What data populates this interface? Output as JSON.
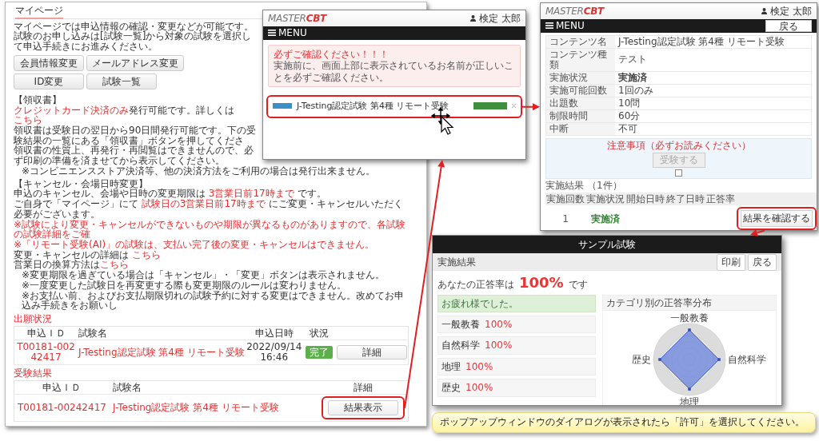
{
  "mypage": {
    "title": "マイページ",
    "intro": [
      "マイページでは申込情報の確認・変更などが可能です。",
      "試験のお申し込みは[試験一覧]から対象の試験を選択して申込手続きにお進みください。"
    ],
    "buttons": [
      "会員情報変更",
      "メールアドレス変更",
      "ID変更",
      "試験一覧"
    ],
    "notes": [
      {
        "kind": "heading",
        "text": "【領収書】"
      },
      {
        "kind": "text",
        "text": "**クレジットカード決済のみ**発行可能です。詳しくは",
        "link": "こちら"
      },
      {
        "kind": "text",
        "text": "領収書は受験日の翌日から90日間発行可能です。下の受験結果の一覧にある「領収書」ボタンを押してくださ"
      },
      {
        "kind": "text",
        "text": "領収書の性質上、再発行・再閲覧はできませんので、必ず印刷の準備を済ませてから表示してください。"
      },
      {
        "kind": "note",
        "text": "※コンビニエンスストア決済等、他の決済方法をご利用の場合は発行出来ません。"
      },
      {
        "kind": "heading",
        "text": "【キャンセル・会場日時変更】"
      },
      {
        "kind": "text",
        "text": "申込のキャンセル、会場や日時の変更期限は **3営業日前17時まで** です。"
      },
      {
        "kind": "text",
        "text": "ご自身で「マイページ」にて **試験日の3営業日前17時まで** にご変更・キャンセルいただく必要がございます。"
      },
      {
        "kind": "warning",
        "text": "※試験により変更・キャンセルができないものや期限が異なるものがありますので、各試験の試験詳細をご確"
      },
      {
        "kind": "warning",
        "text": "※「リモート受験(AI)」の試験は、支払い完了後の変更・キャンセルはできません。"
      },
      {
        "kind": "text",
        "text": "変更・キャンセルの詳細は ",
        "link": "こちら"
      },
      {
        "kind": "text",
        "text": "営業日の換算方法は",
        "link": "こちら"
      },
      {
        "kind": "note",
        "text": "※変更期限を過ぎている場合は「キャンセル」・「変更」ボタンは表示されません。"
      },
      {
        "kind": "note",
        "text": "※一度変更した試験日を再変更する際も変更期限のルールは変わりません。"
      },
      {
        "kind": "note",
        "text": "※お支払い前、およびお支払期限切れの試験予約に対する変更はできません。改めてお申込み手続きをお願いし"
      }
    ],
    "status_table": {
      "heading": "出願状況",
      "columns": [
        "申込ＩＤ",
        "試験名",
        "申込日時",
        "状況"
      ],
      "rows": [
        {
          "id": "T00181-00242417",
          "name": "J-Testing認定試験 第4種 リモート受験",
          "date": "2022/09/14 16:46",
          "status": "完了",
          "action": "詳細"
        }
      ]
    },
    "results_table": {
      "heading": "受験結果",
      "columns": [
        "申込ＩＤ",
        "試験名",
        "詳細"
      ],
      "rows": [
        {
          "id": "T00181-00242417",
          "name": "J-Testing認定試験 第4種 リモート受験",
          "action": "結果表示",
          "highlighted": true
        }
      ]
    }
  },
  "exam_list": {
    "logo": "MASTER**CBT**",
    "user_name": "検定 太郎",
    "menu_label": "MENU",
    "alert": {
      "title": "必ずご確認ください！！！",
      "message": "実施前に、画面上部に表示されているお名前が正しいことを必ずご確認ください。"
    },
    "exams": [
      {
        "name": "J-Testing認定試験 第4種 リモート受験",
        "highlighted": true
      }
    ]
  },
  "exam_detail": {
    "logo": "MASTER**CBT**",
    "user_name": "検定 太郎",
    "menu_label": "MENU",
    "back_button": "戻る",
    "details": [
      {
        "label": "コンテンツ名",
        "value": "J-Testing認定試験 第4種 リモート受験",
        "kind": "text"
      },
      {
        "label": "コンテンツ種類",
        "value": "テスト",
        "kind": "text"
      },
      {
        "label": "実施状況",
        "value": "実施済",
        "kind": "status"
      },
      {
        "label": "実施可能回数",
        "value": "1回のみ",
        "kind": "text"
      },
      {
        "label": "出題数",
        "value": "10問",
        "kind": "text"
      },
      {
        "label": "制限時間",
        "value": "60分",
        "kind": "text"
      },
      {
        "label": "中断",
        "value": "不可",
        "kind": "text"
      }
    ],
    "notice": {
      "title": "注意事項（必ずお読みください）",
      "button": "受験する",
      "button_disabled": true,
      "checked": false
    },
    "results": {
      "title": "実施結果",
      "count": "（1件）",
      "columns": [
        "実施回数",
        "実施状況",
        "開始日時",
        "終了日時",
        "正答率"
      ],
      "rows": [
        {
          "cells": [
            {
              "text": "1",
              "kind": "text"
            },
            {
              "text": "実施済",
              "kind": "status"
            }
          ],
          "button": "結果を確認する",
          "highlighted": true
        }
      ]
    }
  },
  "result": {
    "title": "サンプル試験",
    "heading": "実施結果",
    "buttons": [
      "印刷",
      "戻る"
    ],
    "score_label": "あなたの正答率は",
    "score": "100%",
    "score_suffix": "です",
    "message": "お疲れ様でした。",
    "categories": [
      {
        "name": "一般教養",
        "rate": "100%"
      },
      {
        "name": "自然科学",
        "rate": "100%"
      },
      {
        "name": "地理",
        "rate": "100%"
      },
      {
        "name": "歴史",
        "rate": "100%"
      }
    ],
    "chart_title": "カテゴリ別の正答率分布",
    "radar_labels": [
      "一般教養",
      "自然科学",
      "地理",
      "歴史"
    ]
  },
  "callout": {
    "text": "ポップアップウィンドウのダイアログが表示されたら「許可」を選択してください。"
  }
}
